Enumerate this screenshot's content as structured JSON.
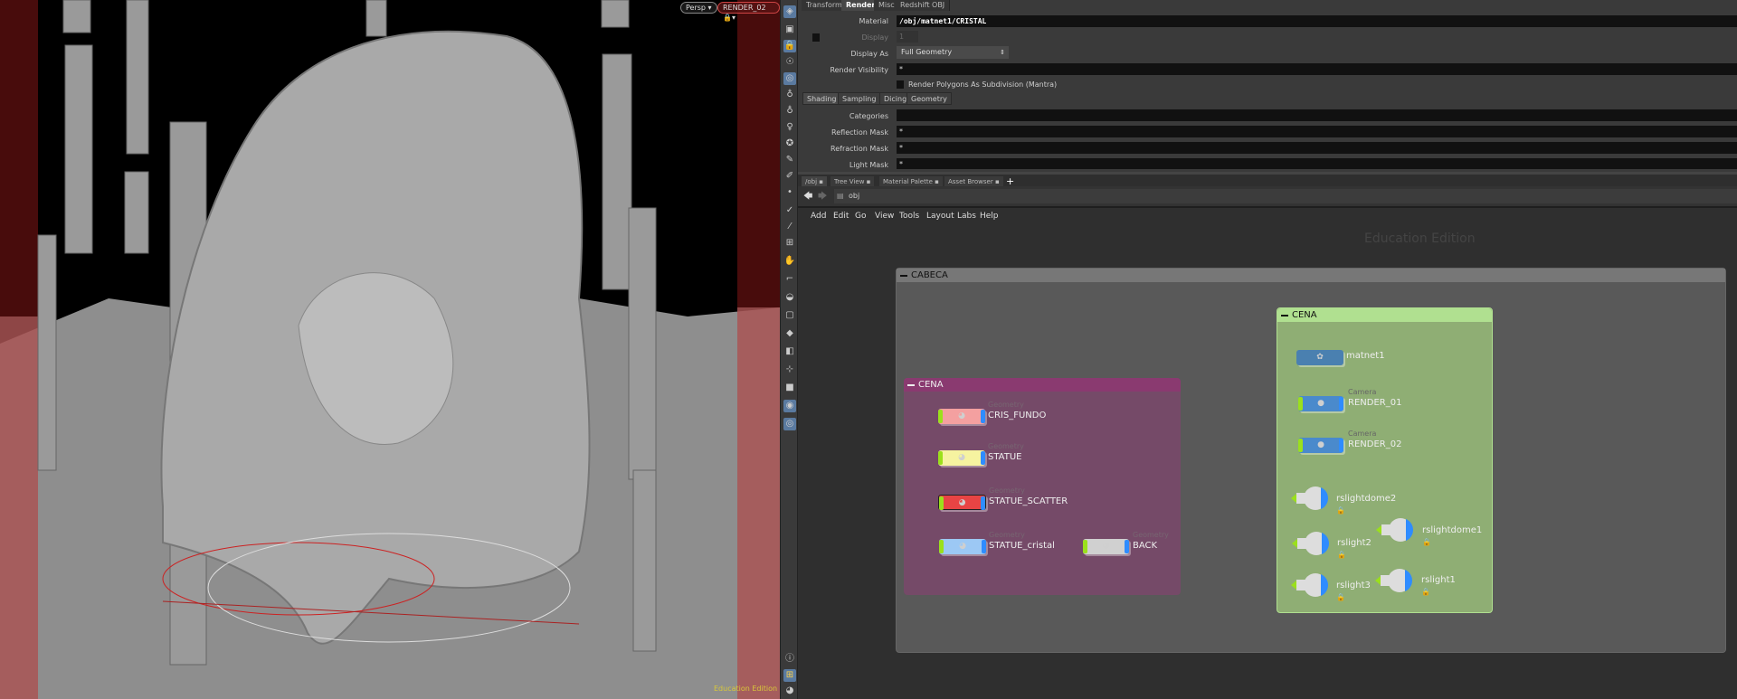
{
  "viewport": {
    "camera_menu": "Persp",
    "render_cam_menu": "RENDER_02",
    "watermark": "Education Edition"
  },
  "params": {
    "tabs": [
      "Transform",
      "Render",
      "Misc",
      "Redshift OBJ"
    ],
    "active_tab": "Render",
    "material_label": "Material",
    "material_value": "/obj/matnet1/CRISTAL",
    "display_label": "Display",
    "display_value": "1",
    "display_as_label": "Display As",
    "display_as_value": "Full Geometry",
    "render_visibility_label": "Render Visibility",
    "render_visibility_value": "*",
    "subdiv_label": "Render Polygons As Subdivision (Mantra)",
    "subtabs": [
      "Shading",
      "Sampling",
      "Dicing",
      "Geometry"
    ],
    "categories_label": "Categories",
    "categories_value": "",
    "reflection_label": "Reflection Mask",
    "reflection_value": "*",
    "refraction_label": "Refraction Mask",
    "refraction_value": "*",
    "light_label": "Light Mask",
    "light_value": "*"
  },
  "pane_tabs": [
    "/obj",
    "Tree View",
    "Material Palette",
    "Asset Browser"
  ],
  "path": "obj",
  "menu": [
    "Add",
    "Edit",
    "Go",
    "View",
    "Tools",
    "Layout",
    "Labs",
    "Help"
  ],
  "network": {
    "watermark": "Education Edition",
    "outer_box": "CABECA",
    "purple_box": {
      "title": "CENA",
      "color": "#7a4a6b",
      "nodes": [
        {
          "type": "Geometry",
          "name": "CRIS_FUNDO",
          "color": "#f4a0a0"
        },
        {
          "type": "Geometry",
          "name": "STATUE",
          "color": "#f6f3a0"
        },
        {
          "type": "Geometry",
          "name": "STATUE_SCATTER",
          "color": "#e84444"
        },
        {
          "type": "Geometry",
          "name": "STATUE_cristal",
          "color": "#9cc8f4"
        },
        {
          "type": "Geometry",
          "name": "BACK",
          "color": "#d0d0d0"
        }
      ]
    },
    "green_box": {
      "title": "CENA",
      "color": "#8fae74",
      "nodes": [
        {
          "type": "",
          "name": "matnet1"
        },
        {
          "type": "Camera",
          "name": "RENDER_01"
        },
        {
          "type": "Camera",
          "name": "RENDER_02"
        },
        {
          "type": "",
          "name": "rslightdome2"
        },
        {
          "type": "",
          "name": "rslight2"
        },
        {
          "type": "",
          "name": "rslight3"
        },
        {
          "type": "",
          "name": "rslightdome1"
        },
        {
          "type": "",
          "name": "rslight1"
        }
      ]
    }
  }
}
